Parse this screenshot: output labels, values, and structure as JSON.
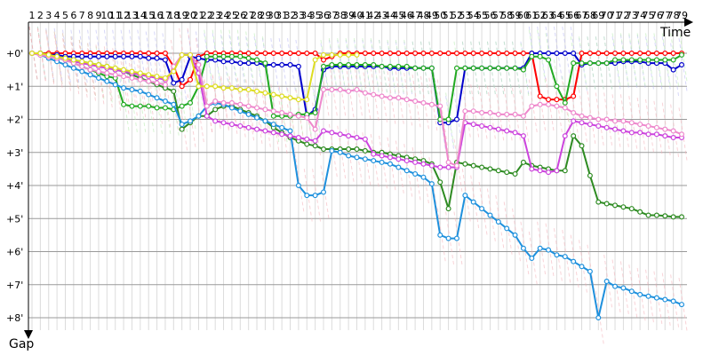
{
  "chart_data": {
    "type": "line",
    "x_axis_label": "Time",
    "y_axis_label": "Gap",
    "x_tick_labels": [
      "1",
      "2",
      "3",
      "4",
      "5",
      "6",
      "7",
      "8",
      "9",
      "10",
      "11",
      "12",
      "13",
      "14",
      "15",
      "16",
      "17",
      "18",
      "19",
      "20",
      "21",
      "22",
      "23",
      "24",
      "25",
      "26",
      "27",
      "28",
      "29",
      "30",
      "31",
      "32",
      "33",
      "34",
      "35",
      "36",
      "37",
      "38",
      "39",
      "40",
      "41",
      "42",
      "43",
      "44",
      "45",
      "46",
      "47",
      "48",
      "49",
      "50",
      "51",
      "52",
      "53",
      "54",
      "55",
      "56",
      "57",
      "58",
      "59",
      "60",
      "61",
      "62",
      "63",
      "64",
      "65",
      "66",
      "67",
      "68",
      "69",
      "70",
      "71",
      "72",
      "73",
      "74",
      "75",
      "76",
      "77",
      "78",
      "79"
    ],
    "y_tick_labels": [
      "+0'",
      "+1'",
      "+2'",
      "+3'",
      "+4'",
      "+5'",
      "+6'",
      "+7'",
      "+8'"
    ],
    "xlim": [
      1,
      79
    ],
    "ylim": [
      0,
      8
    ],
    "series": [
      {
        "color": "#ff0000",
        "values": [
          0,
          0,
          0,
          0,
          0,
          0,
          0,
          0,
          0,
          0,
          0,
          0,
          0,
          0,
          0,
          0,
          0,
          0.4,
          1.0,
          0.8,
          0.1,
          0,
          0,
          0,
          0,
          0,
          0,
          0,
          0,
          0,
          0,
          0,
          0,
          0,
          0,
          0.2,
          0.1,
          0,
          0,
          0,
          0,
          0,
          0,
          0,
          0,
          0,
          0,
          0,
          0,
          0,
          0,
          0,
          0,
          0,
          0,
          0,
          0,
          0,
          0,
          0,
          0,
          1.3,
          1.4,
          1.4,
          1.4,
          1.3,
          0,
          0,
          0,
          0,
          0,
          0,
          0,
          0,
          0,
          0,
          0,
          0,
          0
        ]
      },
      {
        "color": "#0000cc",
        "values": [
          0,
          0,
          0.05,
          0.05,
          0.1,
          0.1,
          0.1,
          0.1,
          0.1,
          0.1,
          0.1,
          0.1,
          0.1,
          0.1,
          0.15,
          0.15,
          0.2,
          0.9,
          0.8,
          0.1,
          0.15,
          0.2,
          0.2,
          0.25,
          0.25,
          0.3,
          0.3,
          0.3,
          0.35,
          0.35,
          0.35,
          0.35,
          0.4,
          1.9,
          1.7,
          0.5,
          0.4,
          0.4,
          0.4,
          0.4,
          0.4,
          0.4,
          0.4,
          0.45,
          0.45,
          0.45,
          0.45,
          0.45,
          0.45,
          2.1,
          2.1,
          2.0,
          0.45,
          0.45,
          0.45,
          0.45,
          0.45,
          0.45,
          0.45,
          0.45,
          0,
          0,
          0,
          0,
          0,
          0,
          0.35,
          0.3,
          0.3,
          0.3,
          0.3,
          0.25,
          0.25,
          0.25,
          0.3,
          0.3,
          0.3,
          0.5,
          0.35
        ]
      },
      {
        "color": "#22aa22",
        "values": [
          0,
          0,
          0.1,
          0.15,
          0.2,
          0.3,
          0.4,
          0.5,
          0.6,
          0.7,
          0.75,
          1.55,
          1.6,
          1.6,
          1.6,
          1.65,
          1.65,
          1.7,
          1.6,
          1.5,
          1.0,
          0.1,
          0.1,
          0.1,
          0.1,
          0.1,
          0.15,
          0.2,
          0.3,
          1.9,
          1.9,
          1.9,
          1.85,
          1.85,
          1.8,
          0.4,
          0.35,
          0.35,
          0.35,
          0.35,
          0.35,
          0.35,
          0.4,
          0.4,
          0.4,
          0.4,
          0.45,
          0.45,
          0.45,
          2.0,
          2.0,
          0.45,
          0.45,
          0.45,
          0.45,
          0.45,
          0.45,
          0.45,
          0.45,
          0.5,
          0.1,
          0.1,
          0.2,
          1.0,
          1.5,
          0.3,
          0.3,
          0.3,
          0.3,
          0.3,
          0.2,
          0.2,
          0.2,
          0.2,
          0.2,
          0.2,
          0.2,
          0.2,
          0.05
        ]
      },
      {
        "color": "#2e8b22",
        "values": [
          0,
          0,
          0.05,
          0.1,
          0.15,
          0.2,
          0.25,
          0.3,
          0.35,
          0.4,
          0.5,
          0.55,
          0.65,
          0.75,
          0.85,
          0.95,
          1.05,
          1.15,
          2.3,
          2.1,
          1.9,
          1.9,
          1.7,
          1.6,
          1.6,
          1.7,
          1.8,
          1.9,
          2.05,
          2.25,
          2.4,
          2.55,
          2.65,
          2.75,
          2.8,
          2.9,
          2.9,
          2.9,
          2.9,
          2.9,
          2.95,
          3.0,
          3.0,
          3.05,
          3.1,
          3.15,
          3.2,
          3.25,
          3.35,
          3.9,
          4.7,
          3.3,
          3.35,
          3.4,
          3.45,
          3.5,
          3.55,
          3.6,
          3.65,
          3.3,
          3.4,
          3.45,
          3.5,
          3.55,
          3.55,
          2.5,
          2.8,
          3.7,
          4.5,
          4.55,
          4.6,
          4.65,
          4.7,
          4.8,
          4.9,
          4.9,
          4.92,
          4.95,
          4.95
        ]
      },
      {
        "color": "#1e90dd",
        "values": [
          0,
          0.05,
          0.15,
          0.25,
          0.35,
          0.45,
          0.55,
          0.65,
          0.75,
          0.85,
          0.95,
          1.05,
          1.1,
          1.15,
          1.25,
          1.35,
          1.45,
          1.55,
          2.15,
          2.05,
          1.9,
          1.6,
          1.5,
          1.55,
          1.65,
          1.75,
          1.85,
          1.95,
          2.05,
          2.15,
          2.25,
          2.35,
          4.0,
          4.3,
          4.3,
          4.2,
          2.95,
          3.0,
          3.1,
          3.15,
          3.2,
          3.25,
          3.3,
          3.35,
          3.45,
          3.55,
          3.65,
          3.75,
          3.95,
          5.5,
          5.6,
          5.6,
          4.3,
          4.5,
          4.7,
          4.9,
          5.1,
          5.3,
          5.5,
          5.9,
          6.2,
          5.9,
          5.95,
          6.1,
          6.15,
          6.3,
          6.45,
          6.6,
          8.0,
          6.9,
          7.05,
          7.1,
          7.2,
          7.3,
          7.35,
          7.4,
          7.45,
          7.5,
          7.6
        ]
      },
      {
        "color": "#cc44dd",
        "values": [
          0,
          0.05,
          0.1,
          0.15,
          0.2,
          0.25,
          0.3,
          0.35,
          0.4,
          0.45,
          0.5,
          0.55,
          0.6,
          0.65,
          0.7,
          0.75,
          0.8,
          0.5,
          0.05,
          0.05,
          0.6,
          1.9,
          2.05,
          2.1,
          2.15,
          2.2,
          2.25,
          2.3,
          2.35,
          2.4,
          2.45,
          2.5,
          2.55,
          2.6,
          2.65,
          2.35,
          2.4,
          2.45,
          2.5,
          2.55,
          2.6,
          3.05,
          3.1,
          3.15,
          3.2,
          3.25,
          3.3,
          3.35,
          3.4,
          3.45,
          3.45,
          3.45,
          2.1,
          2.15,
          2.2,
          2.25,
          2.3,
          2.35,
          2.4,
          2.5,
          3.5,
          3.55,
          3.6,
          3.55,
          2.5,
          2.05,
          2.1,
          2.15,
          2.2,
          2.25,
          2.3,
          2.35,
          2.4,
          2.4,
          2.45,
          2.45,
          2.5,
          2.55,
          2.55
        ]
      },
      {
        "color": "#ee88cc",
        "values": [
          0,
          0.05,
          0.1,
          0.15,
          0.2,
          0.3,
          0.4,
          0.5,
          0.55,
          0.6,
          0.65,
          0.7,
          0.75,
          0.8,
          0.85,
          0.9,
          0.95,
          0.4,
          0.05,
          0.05,
          0.35,
          1.6,
          1.45,
          1.5,
          1.5,
          1.55,
          1.6,
          1.65,
          1.7,
          1.75,
          1.8,
          1.85,
          1.9,
          1.95,
          2.3,
          1.1,
          1.1,
          1.1,
          1.15,
          1.1,
          1.2,
          1.25,
          1.3,
          1.35,
          1.35,
          1.4,
          1.45,
          1.5,
          1.55,
          1.6,
          3.3,
          3.4,
          1.75,
          1.75,
          1.8,
          1.8,
          1.85,
          1.85,
          1.85,
          1.9,
          1.6,
          1.55,
          1.55,
          1.6,
          1.65,
          1.8,
          1.9,
          1.95,
          2.0,
          2.0,
          2.05,
          2.05,
          2.1,
          2.15,
          2.2,
          2.25,
          2.3,
          2.35,
          2.45
        ]
      },
      {
        "color": "#dddd22",
        "values": [
          0,
          0,
          0.05,
          0.1,
          0.15,
          0.2,
          0.25,
          0.3,
          0.35,
          0.4,
          0.45,
          0.5,
          0.55,
          0.6,
          0.65,
          0.7,
          0.75,
          0.55,
          0.05,
          0.05,
          1.0,
          1.0,
          1.0,
          1.05,
          1.05,
          1.1,
          1.1,
          1.15,
          1.2,
          1.25,
          1.3,
          1.35,
          1.4,
          1.4,
          0.2,
          0.05,
          0.05,
          0.05,
          0.05,
          0.05
        ]
      }
    ]
  }
}
